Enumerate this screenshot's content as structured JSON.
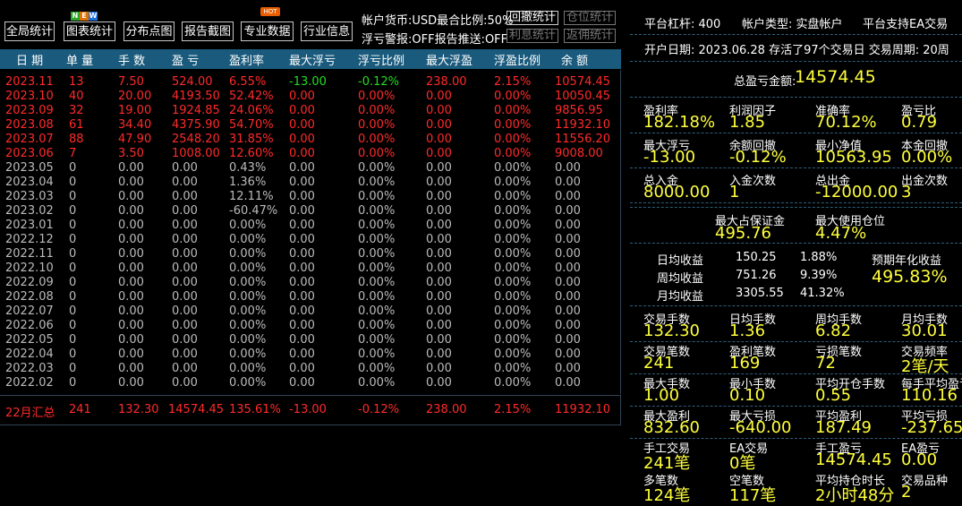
{
  "toolbar": {
    "buttons": [
      "全局统计",
      "图表统计",
      "分布点图",
      "报告截图",
      "专业数据",
      "行业信息"
    ],
    "new_badge": [
      "N",
      "E",
      "W"
    ],
    "hot_badge": "HOT",
    "account_currency_text": "帐户货币:USD最合比例:50%",
    "float_alert_text": "浮亏警报:OFF报告推送:OFF",
    "small_buttons": [
      "回撤统计",
      "仓位统计",
      "利息统计",
      "返佣统计"
    ]
  },
  "table": {
    "headers": [
      "日 期",
      "单 量",
      "手 数",
      "盈 亏",
      "盈利率",
      "最大浮亏",
      "浮亏比例",
      "最大浮盈",
      "浮盈比例",
      "余 额"
    ],
    "rows": [
      [
        "2023.11",
        "13",
        "7.50",
        "524.00",
        "6.55%",
        "-13.00",
        "-0.12%",
        "238.00",
        "2.15%",
        "10574.45"
      ],
      [
        "2023.10",
        "40",
        "20.00",
        "4193.50",
        "52.42%",
        "0.00",
        "0.00%",
        "0.00",
        "0.00%",
        "10050.45"
      ],
      [
        "2023.09",
        "32",
        "19.00",
        "1924.85",
        "24.06%",
        "0.00",
        "0.00%",
        "0.00",
        "0.00%",
        "9856.95"
      ],
      [
        "2023.08",
        "61",
        "34.40",
        "4375.90",
        "54.70%",
        "0.00",
        "0.00%",
        "0.00",
        "0.00%",
        "11932.10"
      ],
      [
        "2023.07",
        "88",
        "47.90",
        "2548.20",
        "31.85%",
        "0.00",
        "0.00%",
        "0.00",
        "0.00%",
        "11556.20"
      ],
      [
        "2023.06",
        "7",
        "3.50",
        "1008.00",
        "12.60%",
        "0.00",
        "0.00%",
        "0.00",
        "0.00%",
        "9008.00"
      ],
      [
        "2023.05",
        "0",
        "0.00",
        "0.00",
        "0.43%",
        "0.00",
        "0.00%",
        "0.00",
        "0.00%",
        "0.00"
      ],
      [
        "2023.04",
        "0",
        "0.00",
        "0.00",
        "1.36%",
        "0.00",
        "0.00%",
        "0.00",
        "0.00%",
        "0.00"
      ],
      [
        "2023.03",
        "0",
        "0.00",
        "0.00",
        "12.11%",
        "0.00",
        "0.00%",
        "0.00",
        "0.00%",
        "0.00"
      ],
      [
        "2023.02",
        "0",
        "0.00",
        "0.00",
        "-60.47%",
        "0.00",
        "0.00%",
        "0.00",
        "0.00%",
        "0.00"
      ],
      [
        "2023.01",
        "0",
        "0.00",
        "0.00",
        "0.00%",
        "0.00",
        "0.00%",
        "0.00",
        "0.00%",
        "0.00"
      ],
      [
        "2022.12",
        "0",
        "0.00",
        "0.00",
        "0.00%",
        "0.00",
        "0.00%",
        "0.00",
        "0.00%",
        "0.00"
      ],
      [
        "2022.11",
        "0",
        "0.00",
        "0.00",
        "0.00%",
        "0.00",
        "0.00%",
        "0.00",
        "0.00%",
        "0.00"
      ],
      [
        "2022.10",
        "0",
        "0.00",
        "0.00",
        "0.00%",
        "0.00",
        "0.00%",
        "0.00",
        "0.00%",
        "0.00"
      ],
      [
        "2022.09",
        "0",
        "0.00",
        "0.00",
        "0.00%",
        "0.00",
        "0.00%",
        "0.00",
        "0.00%",
        "0.00"
      ],
      [
        "2022.08",
        "0",
        "0.00",
        "0.00",
        "0.00%",
        "0.00",
        "0.00%",
        "0.00",
        "0.00%",
        "0.00"
      ],
      [
        "2022.07",
        "0",
        "0.00",
        "0.00",
        "0.00%",
        "0.00",
        "0.00%",
        "0.00",
        "0.00%",
        "0.00"
      ],
      [
        "2022.06",
        "0",
        "0.00",
        "0.00",
        "0.00%",
        "0.00",
        "0.00%",
        "0.00",
        "0.00%",
        "0.00"
      ],
      [
        "2022.05",
        "0",
        "0.00",
        "0.00",
        "0.00%",
        "0.00",
        "0.00%",
        "0.00",
        "0.00%",
        "0.00"
      ],
      [
        "2022.04",
        "0",
        "0.00",
        "0.00",
        "0.00%",
        "0.00",
        "0.00%",
        "0.00",
        "0.00%",
        "0.00"
      ],
      [
        "2022.03",
        "0",
        "0.00",
        "0.00",
        "0.00%",
        "0.00",
        "0.00%",
        "0.00",
        "0.00%",
        "0.00"
      ],
      [
        "2022.02",
        "0",
        "0.00",
        "0.00",
        "0.00%",
        "0.00",
        "0.00%",
        "0.00",
        "0.00%",
        "0.00"
      ]
    ],
    "summary": [
      "22月汇总",
      "241",
      "132.30",
      "14574.45",
      "135.61%",
      "-13.00",
      "-0.12%",
      "238.00",
      "2.15%",
      "11932.10"
    ]
  },
  "panel": {
    "platform_leverage": "平台杠杆: 400",
    "account_type": "帐户类型: 实盘帐户",
    "ea_support": "平台支持EA交易",
    "open_info": "开户日期: 2023.06.28  存活了97个交易日  交易周期: 20周",
    "total_pnl_label": "总盈亏金额:",
    "total_pnl_value": "14574.45",
    "grid": [
      [
        [
          "盈利率",
          "182.18%"
        ],
        [
          "利润因子",
          "1.85"
        ],
        [
          "准确率",
          "70.12%"
        ],
        [
          "盈亏比",
          "0.79"
        ]
      ],
      [
        [
          "最大浮亏",
          "-13.00"
        ],
        [
          "余额回撤",
          "-0.12%"
        ],
        [
          "最小净值",
          "10563.95"
        ],
        [
          "本金回撤",
          "0.00%"
        ]
      ],
      [
        [
          "总入金",
          "8000.00"
        ],
        [
          "入金次数",
          "1"
        ],
        [
          "总出金",
          "-12000.00"
        ],
        [
          "出金次数",
          "3"
        ]
      ]
    ],
    "margin": [
      [
        "最大占保证金",
        "495.76"
      ],
      [
        "最大使用仓位",
        "4.47%"
      ]
    ],
    "returns": [
      [
        "日均收益",
        "150.25",
        "1.88%"
      ],
      [
        "周均收益",
        "751.26",
        "9.39%"
      ],
      [
        "月均收益",
        "3305.55",
        "41.32%"
      ]
    ],
    "annual_label": "预期年化收益",
    "annual_value": "495.83%",
    "grid2": [
      [
        [
          "交易手数",
          "132.30"
        ],
        [
          "日均手数",
          "1.36"
        ],
        [
          "周均手数",
          "6.82"
        ],
        [
          "月均手数",
          "30.01"
        ]
      ],
      [
        [
          "交易笔数",
          "241"
        ],
        [
          "盈利笔数",
          "169"
        ],
        [
          "亏损笔数",
          "72"
        ],
        [
          "交易频率",
          "2笔/天"
        ]
      ],
      [
        [
          "最大手数",
          "1.00"
        ],
        [
          "最小手数",
          "0.10"
        ],
        [
          "平均开仓手数",
          "0.55"
        ],
        [
          "每手平均盈亏",
          "110.16"
        ]
      ],
      [
        [
          "最大盈利",
          "832.60"
        ],
        [
          "最大亏损",
          "-640.00"
        ],
        [
          "平均盈利",
          "187.49"
        ],
        [
          "平均亏损",
          "-237.65"
        ]
      ],
      [
        [
          "手工交易",
          "241笔"
        ],
        [
          "EA交易",
          "0笔"
        ],
        [
          "手工盈亏",
          "14574.45"
        ],
        [
          "EA盈亏",
          "0.00"
        ]
      ],
      [
        [
          "多笔数",
          "124笔"
        ],
        [
          "空笔数",
          "117笔"
        ],
        [
          "平均持仓时长",
          "2小时48分"
        ],
        [
          "交易品种",
          "2"
        ]
      ]
    ]
  },
  "colors": {
    "header_bg": "#1a5a7c",
    "loss_red": "#ff2a2a",
    "value_yellow": "#ffff3c",
    "positive_green": "#22dd22",
    "muted_gray": "#bbbbbb"
  }
}
